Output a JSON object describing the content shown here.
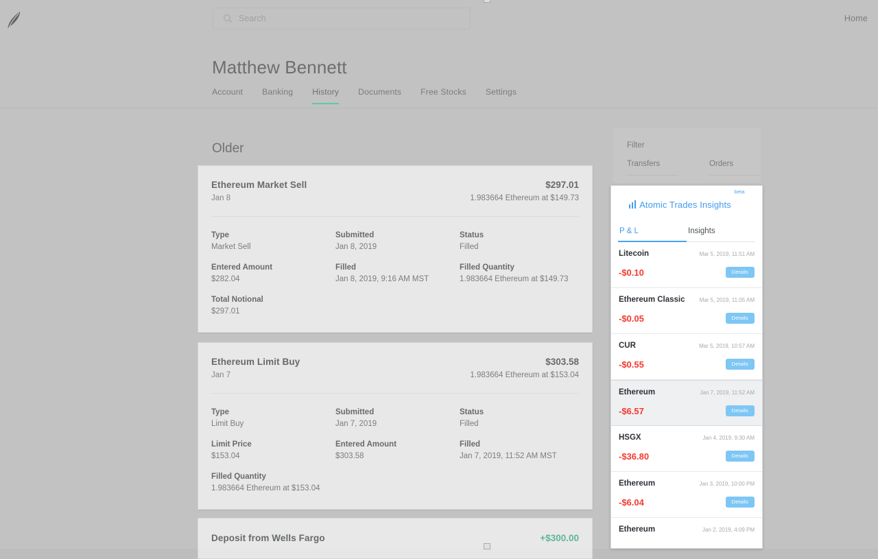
{
  "topbar": {
    "logo_icon": "feather-logo",
    "search_placeholder": "Search",
    "search_value": "",
    "search_icon": "search-icon",
    "home_label": "Home"
  },
  "header": {
    "title": "Matthew Bennett",
    "tabs": [
      {
        "label": "Account",
        "active": false
      },
      {
        "label": "Banking",
        "active": false
      },
      {
        "label": "History",
        "active": true
      },
      {
        "label": "Documents",
        "active": false
      },
      {
        "label": "Free Stocks",
        "active": false
      },
      {
        "label": "Settings",
        "active": false
      }
    ],
    "active_accent": "#21ce99"
  },
  "main": {
    "section_label": "Older",
    "transactions": [
      {
        "title": "Ethereum Market Sell",
        "date": "Jan 8",
        "amount": "$297.01",
        "subtitle": "1.983664 Ethereum at $149.73",
        "fields": [
          {
            "label": "Type",
            "value": "Market Sell"
          },
          {
            "label": "Submitted",
            "value": "Jan 8, 2019"
          },
          {
            "label": "Status",
            "value": "Filled"
          },
          {
            "label": "Entered Amount",
            "value": "$282.04"
          },
          {
            "label": "Filled",
            "value": "Jan 8, 2019, 9:16 AM MST"
          },
          {
            "label": "Filled Quantity",
            "value": "1.983664 Ethereum at $149.73"
          },
          {
            "label": "Total Notional",
            "value": "$297.01"
          }
        ]
      },
      {
        "title": "Ethereum Limit Buy",
        "date": "Jan 7",
        "amount": "$303.58",
        "subtitle": "1.983664 Ethereum at $153.04",
        "fields": [
          {
            "label": "Type",
            "value": "Limit Buy"
          },
          {
            "label": "Submitted",
            "value": "Jan 7, 2019"
          },
          {
            "label": "Status",
            "value": "Filled"
          },
          {
            "label": "Limit Price",
            "value": "$153.04"
          },
          {
            "label": "Entered Amount",
            "value": "$303.58"
          },
          {
            "label": "Filled",
            "value": "Jan 7, 2019, 11:52 AM MST"
          },
          {
            "label": "Filled Quantity",
            "value": "1.983664 Ethereum at $153.04"
          }
        ]
      }
    ],
    "partial_transaction": {
      "title": "Deposit from Wells Fargo",
      "amount": "+$300.00",
      "amount_color": "#21b07c"
    }
  },
  "filter_panel": {
    "label": "Filter",
    "tabs": [
      {
        "label": "Transfers"
      },
      {
        "label": "Orders"
      }
    ]
  },
  "insights_panel": {
    "brand_icon": "bar-chart-icon",
    "brand_name": "Atomic Trades Insights",
    "brand_badge": "beta",
    "brand_color": "#3f9cf0",
    "tabs": [
      {
        "label": "P & L",
        "active": true
      },
      {
        "label": "Insights",
        "active": false
      }
    ],
    "details_label": "Details",
    "rows": [
      {
        "name": "Litecoin",
        "time": "Mar 5, 2019, 11:51 AM",
        "amount": "-$0.10",
        "selected": false
      },
      {
        "name": "Ethereum Classic",
        "time": "Mar 5, 2019, 11:05 AM",
        "amount": "-$0.05",
        "selected": false
      },
      {
        "name": "CUR",
        "time": "Mar 5, 2019, 10:57 AM",
        "amount": "-$0.55",
        "selected": false
      },
      {
        "name": "Ethereum",
        "time": "Jan 7, 2019, 11:52 AM",
        "amount": "-$6.57",
        "selected": true
      },
      {
        "name": "HSGX",
        "time": "Jan 4, 2019, 9:30 AM",
        "amount": "-$36.80",
        "selected": false
      },
      {
        "name": "Ethereum",
        "time": "Jan 3, 2019, 10:00 PM",
        "amount": "-$6.04",
        "selected": false
      },
      {
        "name": "Ethereum",
        "time": "Jan 2, 2019, 4:09 PM",
        "amount": "",
        "selected": false
      }
    ],
    "negative_color": "#f4392e",
    "details_button_color": "#7ec6f4"
  }
}
